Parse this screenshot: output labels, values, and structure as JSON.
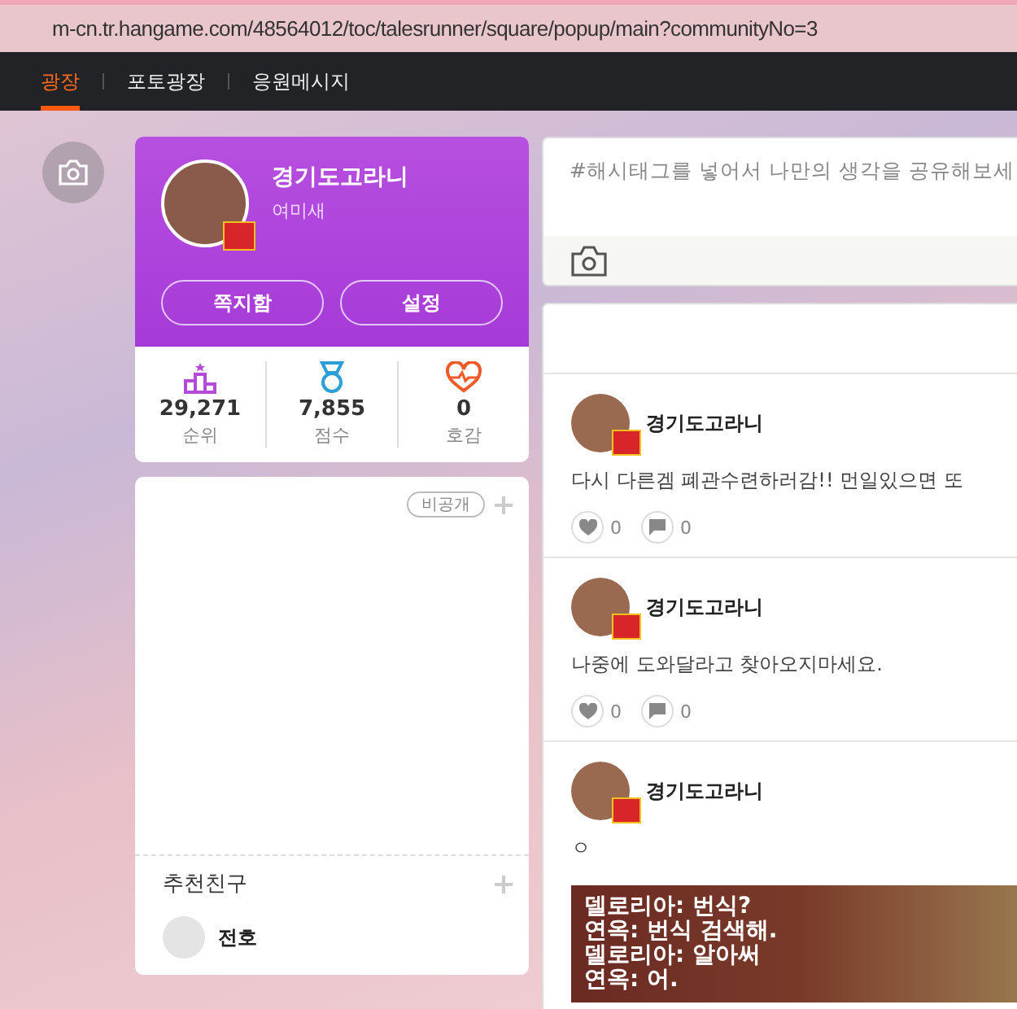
{
  "address_bar": {
    "url": "m-cn.tr.hangame.com/48564012/toc/talesrunner/square/popup/main?communityNo=3"
  },
  "nav": {
    "tabs": [
      {
        "label": "광장",
        "selected": true
      },
      {
        "label": "포토광장",
        "selected": false
      },
      {
        "label": "응원메시지",
        "selected": false
      }
    ]
  },
  "profile": {
    "name": "경기도고라니",
    "subtitle": "여미새",
    "buttons": [
      "쪽지함",
      "설정"
    ],
    "stats": [
      {
        "kind": "rank",
        "value": "29,271",
        "label": "순위"
      },
      {
        "kind": "score",
        "value": "7,855",
        "label": "점수"
      },
      {
        "kind": "like",
        "value": "0",
        "label": "호감"
      }
    ]
  },
  "memo": {
    "badge": "비공개"
  },
  "friends": {
    "title": "추천친구",
    "items": [
      {
        "name": "전호"
      }
    ]
  },
  "composer": {
    "placeholder": "#해시태그를 넣어서 나만의 생각을 공유해보세"
  },
  "posts": [
    {
      "author": "경기도고라니",
      "text": "다시 다른겜 폐관수련하러감!! 먼일있으면 또",
      "likes": "0",
      "comments": "0"
    },
    {
      "author": "경기도고라니",
      "text": "나중에 도와달라고 찾아오지마세요.",
      "likes": "0",
      "comments": "0"
    },
    {
      "author": "경기도고라니",
      "text": "ㅇ",
      "image_lines": [
        "델로리아: 번식?",
        "연옥: 번식 검색해.",
        "델로리아: 알아써",
        "연옥: 어."
      ]
    }
  ]
}
